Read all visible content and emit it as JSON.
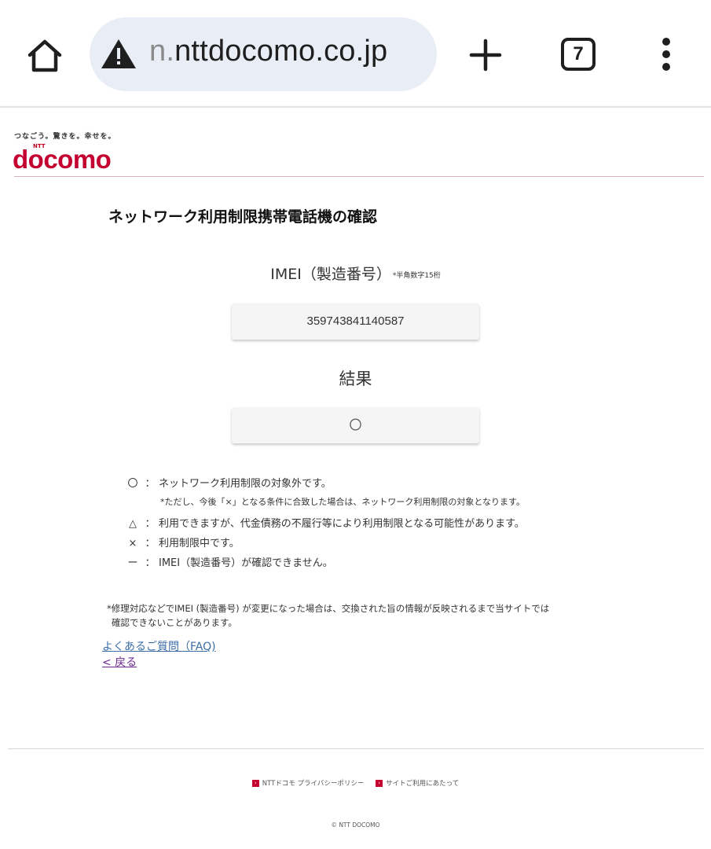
{
  "browser": {
    "url_prefix": "n.",
    "url_domain": "nttdocomo.co.jp",
    "tab_count": "7",
    "icons": {
      "home": "home-icon",
      "warning": "warning-icon",
      "add_tab": "plus-icon",
      "menu": "more-vert-icon"
    }
  },
  "header": {
    "tagline": "つなごう。驚きを。幸せを。",
    "ntt": "NTT",
    "logo": "docomo",
    "brand_color": "#c3002f"
  },
  "page": {
    "title": "ネットワーク利用制限携帯電話機の確認",
    "imei_label": "IMEI（製造番号）",
    "imei_note": "*半角数字15桁",
    "imei_value": "359743841140587",
    "result_label": "結果",
    "result_value": "〇"
  },
  "legend": [
    {
      "symbol": "〇",
      "text": "ネットワーク利用制限の対象外です。"
    },
    {
      "sub": "*ただし、今後「×」となる条件に合致した場合は、ネットワーク利用制限の対象となります。"
    },
    {
      "symbol": "△",
      "text": "利用できますが、代金債務の不履行等により利用制限となる可能性があります。"
    },
    {
      "symbol": "×",
      "text": "利用制限中です。"
    },
    {
      "symbol": "ー",
      "text": "IMEI（製造番号）が確認できません。"
    }
  ],
  "legend_colon": "：",
  "footnote": {
    "line1": "*修理対応などでIMEI (製造番号) が変更になった場合は、交換された旨の情報が反映されるまで当サイトでは",
    "line2": "確認できないことがあります。"
  },
  "links": {
    "faq": "よくあるご質問（FAQ)",
    "back": "< 戻る"
  },
  "footer": {
    "privacy": "NTTドコモ プライバシーポリシー",
    "site_terms": "サイトご利用にあたって",
    "copyright": "© NTT DOCOMO"
  }
}
